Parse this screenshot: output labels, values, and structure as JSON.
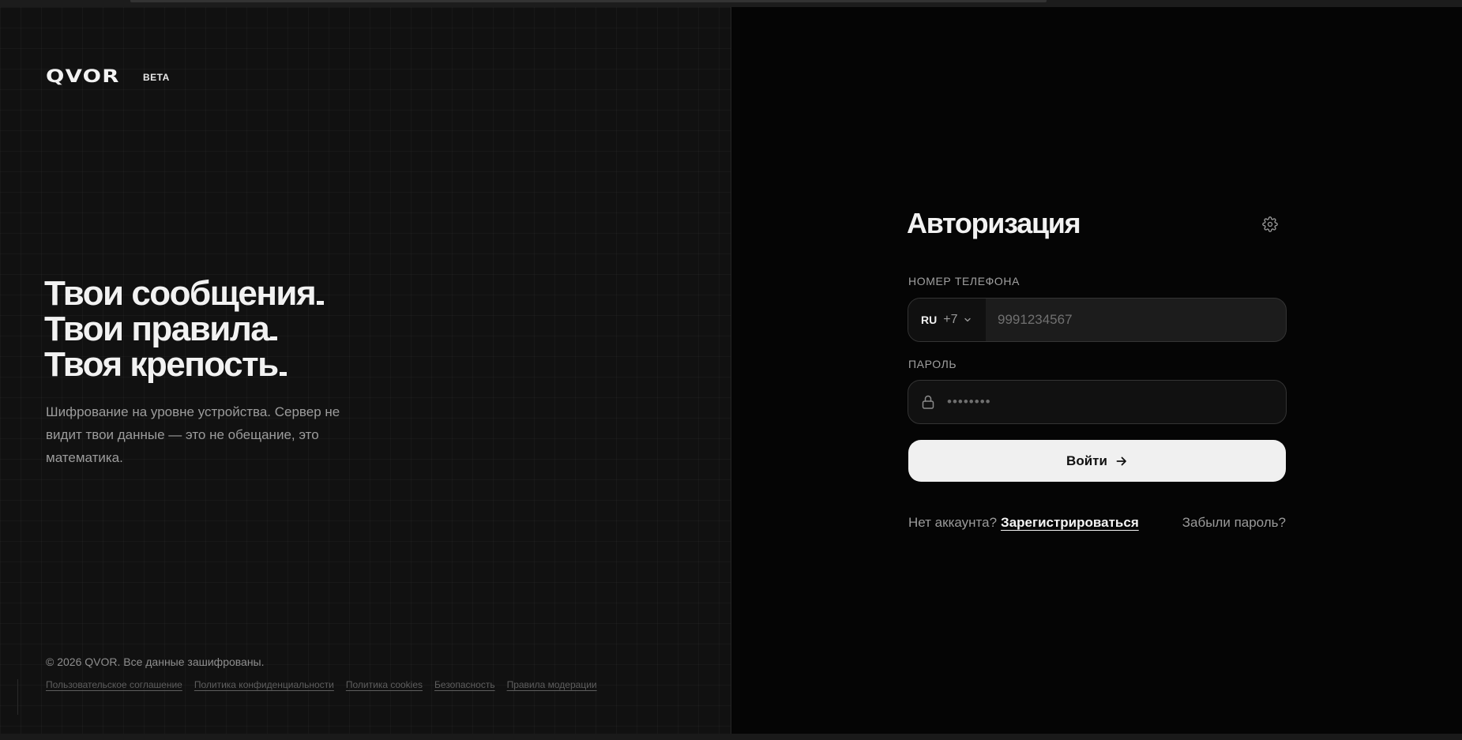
{
  "brand": {
    "logo": "QVOR",
    "badge": "BETA"
  },
  "hero": {
    "lines": [
      "Твои сообщения",
      "Твои правила",
      "Твоя крепость"
    ],
    "description": "Шифрование на уровне устройства. Сервер не видит твои данные — это не обещание, это математика."
  },
  "footer": {
    "copyright": "© 2026 QVOR. Все данные зашифрованы.",
    "links": [
      "Пользовательское соглашение",
      "Политика конфиденциальности",
      "Политика cookies",
      "Безопасность",
      "Правила модерации"
    ]
  },
  "auth": {
    "title": "Авторизация",
    "settings_icon": "gear-icon",
    "phone_label": "НОМЕР ТЕЛЕФОНА",
    "country_iso": "RU",
    "country_code": "+7",
    "phone_placeholder": "9991234567",
    "password_label": "ПАРОЛЬ",
    "password_placeholder": "••••••••",
    "submit_label": "Войти",
    "no_account": "Нет аккаунта?",
    "register": "Зарегистрироваться",
    "forgot": "Забыли пароль?"
  },
  "colors": {
    "accent": "#f0f0f0",
    "background_left": "#111111",
    "background_right": "#050505"
  }
}
